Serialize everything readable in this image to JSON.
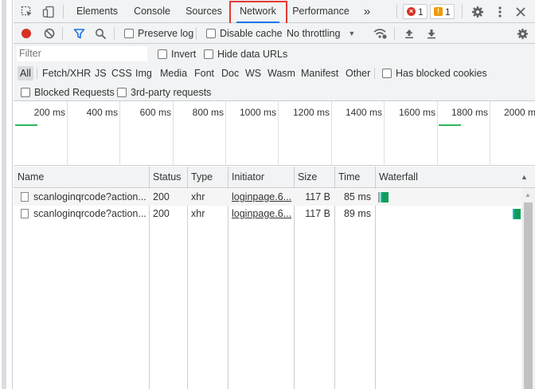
{
  "tabs": [
    "Elements",
    "Console",
    "Sources",
    "Network",
    "Performance"
  ],
  "more_tabs_glyph": "»",
  "error_count": "1",
  "warning_count": "1",
  "toolbar": {
    "preserve_log": "Preserve log",
    "disable_cache": "Disable cache",
    "throttling": "No throttling"
  },
  "filter": {
    "placeholder": "Filter",
    "invert": "Invert",
    "hide_data_urls": "Hide data URLs"
  },
  "type_filters": [
    "All",
    "Fetch/XHR",
    "JS",
    "CSS",
    "Img",
    "Media",
    "Font",
    "Doc",
    "WS",
    "Wasm",
    "Manifest",
    "Other"
  ],
  "has_blocked_cookies": "Has blocked cookies",
  "blocked_requests": "Blocked Requests",
  "third_party": "3rd-party requests",
  "overview_ticks": [
    "200 ms",
    "400 ms",
    "600 ms",
    "800 ms",
    "1000 ms",
    "1200 ms",
    "1400 ms",
    "1600 ms",
    "1800 ms",
    "2000 ms"
  ],
  "columns": [
    "Name",
    "Status",
    "Type",
    "Initiator",
    "Size",
    "Time",
    "Waterfall"
  ],
  "requests": [
    {
      "name": "scanloginqrcode?action...",
      "status": "200",
      "type": "xhr",
      "initiator": "loginpage.6...",
      "size": "117 B",
      "time": "85 ms"
    },
    {
      "name": "scanloginqrcode?action...",
      "status": "200",
      "type": "xhr",
      "initiator": "loginpage.6...",
      "size": "117 B",
      "time": "89 ms"
    }
  ],
  "colors": {
    "accent": "#1a73e8",
    "highlight_box": "#e53935",
    "record": "#d93025",
    "waterfall_bar": "#0f9d58"
  }
}
